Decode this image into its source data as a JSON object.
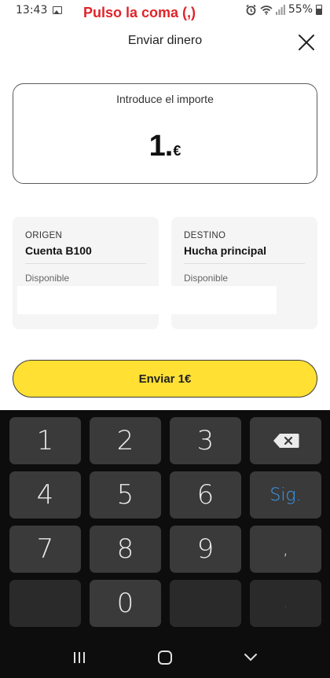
{
  "status_bar": {
    "time": "13:43",
    "annotation": "Pulso la coma (,)",
    "battery": "55%",
    "icons": [
      "gallery-icon",
      "alarm-icon",
      "wifi-icon",
      "signal-icon",
      "battery-icon"
    ]
  },
  "header": {
    "title": "Enviar dinero",
    "close_icon": "close-icon"
  },
  "amount": {
    "label": "Introduce el importe",
    "value": "1.",
    "currency": "€"
  },
  "origin": {
    "label": "ORIGEN",
    "account": "Cuenta B100",
    "available_label": "Disponible"
  },
  "destination": {
    "label": "DESTINO",
    "account": "Hucha principal",
    "available_label": "Disponible"
  },
  "send_button": {
    "label": "Enviar 1€"
  },
  "keyboard": {
    "keys": [
      "1",
      "2",
      "3",
      "4",
      "5",
      "6",
      "7",
      "8",
      "9",
      "0"
    ],
    "next_label": "Sig.",
    "comma": ",",
    "comma_dim": ",",
    "backspace_icon": "backspace-icon"
  },
  "nav": {
    "icons": [
      "recent-apps-icon",
      "home-icon",
      "back-icon"
    ]
  },
  "colors": {
    "accent_yellow": "#ffe033",
    "annotation_red": "#e0242a",
    "next_blue": "#3d9cf0",
    "keyboard_bg": "#0d0d0d",
    "key_bg": "#3a3a3a"
  }
}
